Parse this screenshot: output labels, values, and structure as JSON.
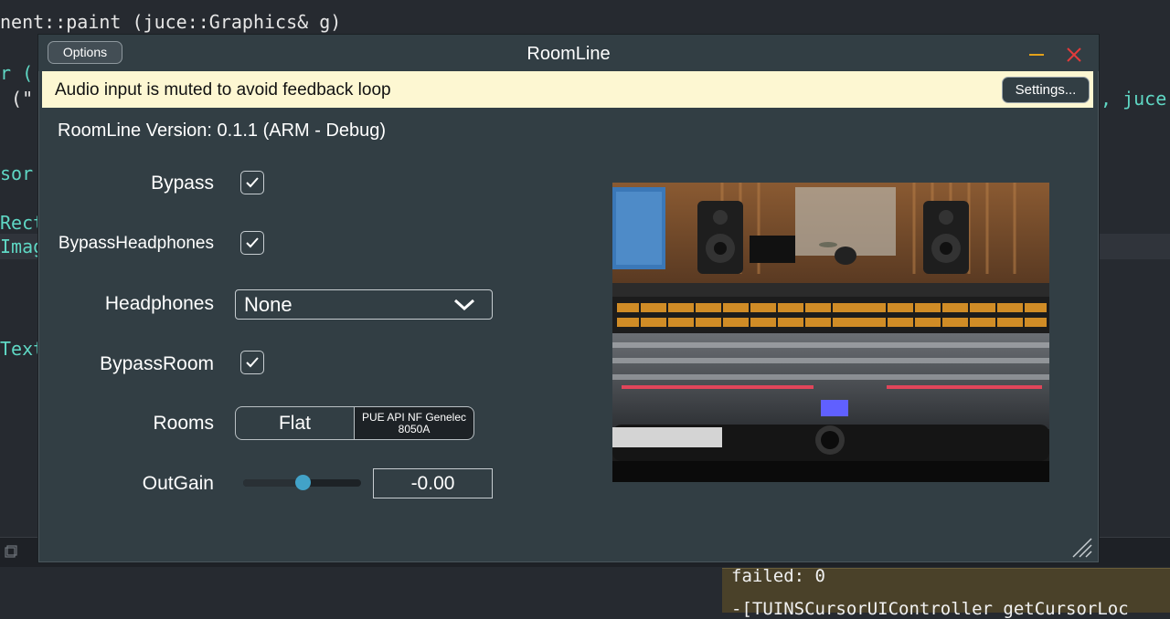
{
  "editor": {
    "line1": "nent::paint (juce::Graphics& g)",
    "frag_r": "r (",
    "frag_quote": " (\"",
    "frag_juce": ", juce",
    "frag_sor": "sor",
    "frag_rect": "Rect",
    "frag_imag": "Imag",
    "frag_text": "Text",
    "console_line1": "failed: 0",
    "console_line2": "-[TUINSCursorUIController getCursorLoc"
  },
  "window": {
    "title": "RoomLine",
    "options_label": "Options",
    "banner_text": "Audio input is muted to avoid feedback loop",
    "settings_label": "Settings...",
    "version_text": "RoomLine Version: 0.1.1 (ARM - Debug)"
  },
  "controls": {
    "bypass_label": "Bypass",
    "bypass_checked": true,
    "bypass_headphones_label": "BypassHeadphones",
    "bypass_headphones_checked": true,
    "headphones_label": "Headphones",
    "headphones_value": "None",
    "bypass_room_label": "BypassRoom",
    "bypass_room_checked": true,
    "rooms_label": "Rooms",
    "rooms_options": [
      "Flat",
      "PUE API NF Genelec 8050A"
    ],
    "rooms_selected": "PUE API NF Genelec 8050A",
    "outgain_label": "OutGain",
    "outgain_value": "-0.00",
    "outgain_slider_fraction": 0.5
  },
  "colors": {
    "window_bg": "#323e44",
    "banner_bg": "#fdf7d2",
    "accent": "#42a2c8",
    "close": "#e23b3b",
    "minimize": "#e3a21a"
  },
  "icons": {
    "minimize": "minimize-icon",
    "close": "close-icon",
    "check": "checkmark-icon",
    "dropdown": "chevron-down-icon",
    "resize": "resize-grip-icon"
  }
}
